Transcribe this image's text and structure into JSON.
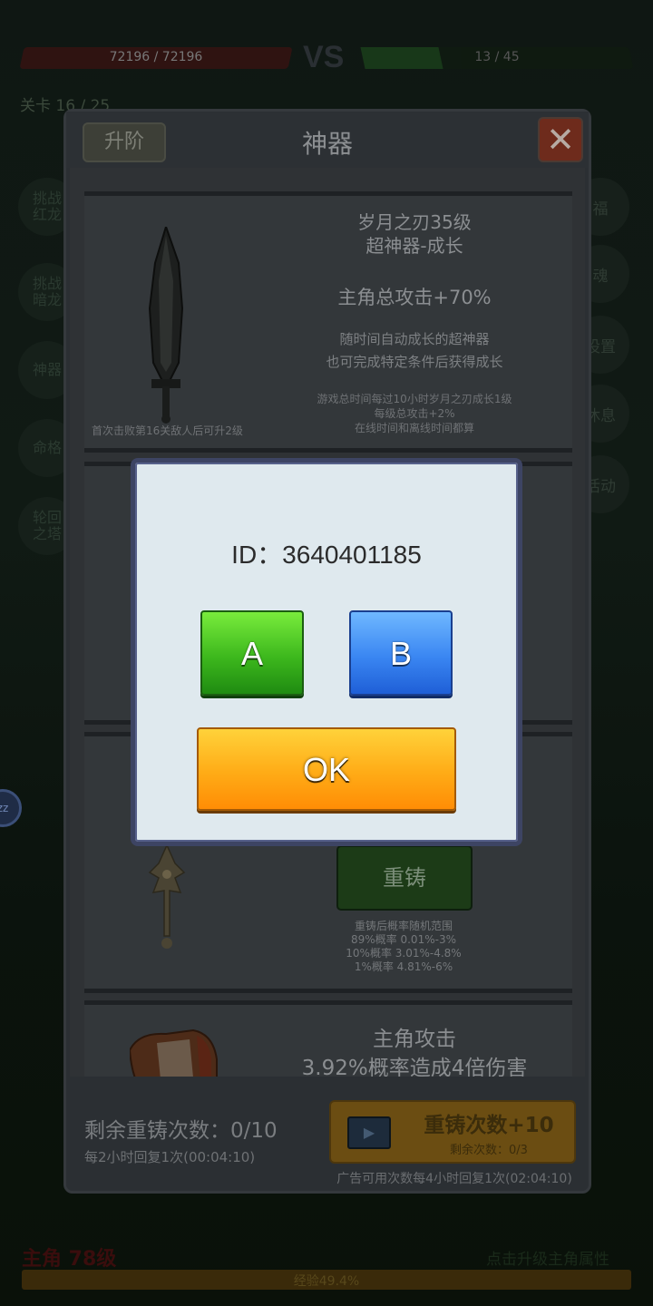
{
  "hud": {
    "player_hp": "72196 / 72196",
    "vs": "VS",
    "enemy_hp": "13 / 45",
    "stage": "关卡 16 / 25"
  },
  "side_menu_left": [
    {
      "label": "挑战\n红龙"
    },
    {
      "label": "挑战\n暗龙"
    },
    {
      "label": "神器"
    },
    {
      "label": "命格"
    },
    {
      "label": "轮回\n之塔"
    }
  ],
  "side_menu_right": [
    {
      "label": "福"
    },
    {
      "label": "魂"
    },
    {
      "label": "设置"
    },
    {
      "label": "休息"
    },
    {
      "label": "活动"
    }
  ],
  "sleep_bubble": "zz",
  "bottom": {
    "hero": "主角  78级",
    "right_text": "点击升级主角属性",
    "exp_text": "经验49.4%"
  },
  "panel": {
    "upgrade_label": "升阶",
    "title": "神器",
    "close_label": "✕",
    "card1": {
      "name_line1": "岁月之刃35级",
      "name_line2": "超神器-成长",
      "attack": "主角总攻击+70%",
      "desc_line1": "随时间自动成长的超神器",
      "desc_line2": "也可完成特定条件后获得成长",
      "rule_line1": "游戏总时间每过10小时岁月之刃成长1级",
      "rule_line2": "每级总攻击+2%",
      "rule_line3": "在线时间和离线时间都算",
      "hint": "首次击败第16关敌人后可升2级"
    },
    "card3": {
      "reforge_label": "重铸",
      "odds_line1": "重铸后概率随机范围",
      "odds_line2": "89%概率 0.01%-3%",
      "odds_line3": "10%概率 3.01%-4.8%",
      "odds_line4": "1%概率 4.81%-6%"
    },
    "card4": {
      "line1": "主角攻击",
      "line2": "3.92%概率造成4倍伤害"
    },
    "footer": {
      "remaining": "剩余重铸次数：0/10",
      "recover": "每2小时回复1次(00:04:10)",
      "ad_main": "重铸次数+10",
      "ad_sub": "剩余次数：0/3",
      "ad_note": "广告可用次数每4小时回复1次(02:04:10)"
    }
  },
  "modal": {
    "id_text": "ID：3640401185",
    "button_a": "A",
    "button_b": "B",
    "button_ok": "OK"
  },
  "colors": {
    "button_a": "#3db81d",
    "button_b": "#3a86f2",
    "button_ok": "#ffab16",
    "modal_bg": "#dfe9ee",
    "modal_border": "#3d4463"
  }
}
